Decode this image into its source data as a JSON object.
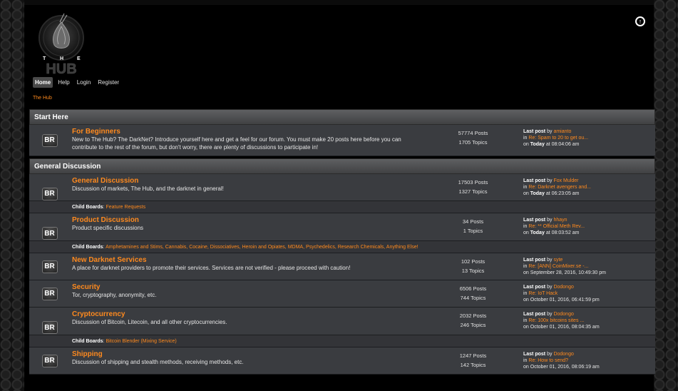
{
  "header": {
    "logo_letters": [
      "T",
      "H",
      "E"
    ],
    "logo_word": "HUB"
  },
  "nav": [
    {
      "label": "Home",
      "active": true
    },
    {
      "label": "Help",
      "active": false
    },
    {
      "label": "Login",
      "active": false
    },
    {
      "label": "Register",
      "active": false
    }
  ],
  "breadcrumb": "The Hub",
  "icons": {
    "top_right": "arrow-up-circle-icon",
    "board": "br-board-icon"
  },
  "colors": {
    "accent": "#ff8a1e",
    "category_bar": "#5f6062",
    "row": "#3a3c40"
  },
  "categories": [
    {
      "title": "Start Here",
      "boards": [
        {
          "icon": "BR",
          "name": "For Beginners",
          "desc": "New to The Hub? The DarkNet? Introduce yourself here and get a feel for our forum. You must make 20 posts here before you can contribute to the rest of the forum, but don't worry, there are plenty of discussions to participate in!",
          "posts": "57774 Posts",
          "topics": "1705 Topics",
          "last_label": "Last post",
          "by": "by",
          "author": "amianto",
          "in": "in",
          "thread": "Re: Spam to 20 to get ou...",
          "on": "on",
          "when_bold": "Today",
          "time": "at 08:04:06 am"
        }
      ]
    },
    {
      "title": "General Discussion",
      "boards": [
        {
          "icon": "BR",
          "name": "General Discussion",
          "desc": "Discussion of markets, The Hub, and the darknet in general!",
          "posts": "17503 Posts",
          "topics": "1327 Topics",
          "last_label": "Last post",
          "by": "by",
          "author": "Fox Mulder",
          "in": "in",
          "thread": "Re: Darknet avengers and...",
          "on": "on",
          "when_bold": "Today",
          "time": "at 06:23:05 am",
          "child_label": "Child Boards",
          "children": "Feature Requests"
        },
        {
          "icon": "BR",
          "name": "Product Discussion",
          "desc": "Product specific discussions",
          "posts": "34 Posts",
          "topics": "1 Topics",
          "last_label": "Last post",
          "by": "by",
          "author": "hhayn",
          "in": "in",
          "thread": "Re: ** Official Meth Rev...",
          "on": "on",
          "when_bold": "Today",
          "time": "at 08:03:52 am",
          "child_label": "Child Boards",
          "children": "Amphetamines and Stims, Cannabis, Cocaine, Dissociatives, Heroin and Opiates, MDMA, Psychedelics, Research Chemicals, Anything Else!"
        },
        {
          "icon": "BR",
          "name": "New Darknet Services",
          "desc": "A place for darknet providers to promote their services. Services are not verified - please proceed with caution!",
          "posts": "102 Posts",
          "topics": "13 Topics",
          "last_label": "Last post",
          "by": "by",
          "author": "syte",
          "in": "in",
          "thread": "Re: [ANN] CoinMixer.se -...",
          "on": "on",
          "when_bold": "",
          "time": "September 28, 2016, 10:49:30 pm"
        },
        {
          "icon": "BR",
          "name": "Security",
          "desc": "Tor, cryptography, anonymity, etc.",
          "posts": "6506 Posts",
          "topics": "744 Topics",
          "last_label": "Last post",
          "by": "by",
          "author": "Dodongo",
          "in": "in",
          "thread": "Re: IoT Hack",
          "on": "on",
          "when_bold": "",
          "time": "October 01, 2016, 06:41:59 pm"
        },
        {
          "icon": "BR",
          "name": "Cryptocurrency",
          "desc": "Discussion of Bitcoin, Litecoin, and all other cryptocurrencies.",
          "posts": "2032 Posts",
          "topics": "246 Topics",
          "last_label": "Last post",
          "by": "by",
          "author": "Dodongo",
          "in": "in",
          "thread": "Re: 100x bitcoins sites ...",
          "on": "on",
          "when_bold": "",
          "time": "October 01, 2016, 08:04:35 am",
          "child_label": "Child Boards",
          "children": "Bitcoin Blender (Mixing Service)"
        },
        {
          "icon": "BR",
          "name": "Shipping",
          "desc": "Discussion of shipping and stealth methods, receiving methods, etc.",
          "posts": "1247 Posts",
          "topics": "142 Topics",
          "last_label": "Last post",
          "by": "by",
          "author": "Dodongo",
          "in": "in",
          "thread": "Re: How to send?",
          "on": "on",
          "when_bold": "",
          "time": "October 01, 2016, 08:06:19 am"
        }
      ]
    }
  ]
}
